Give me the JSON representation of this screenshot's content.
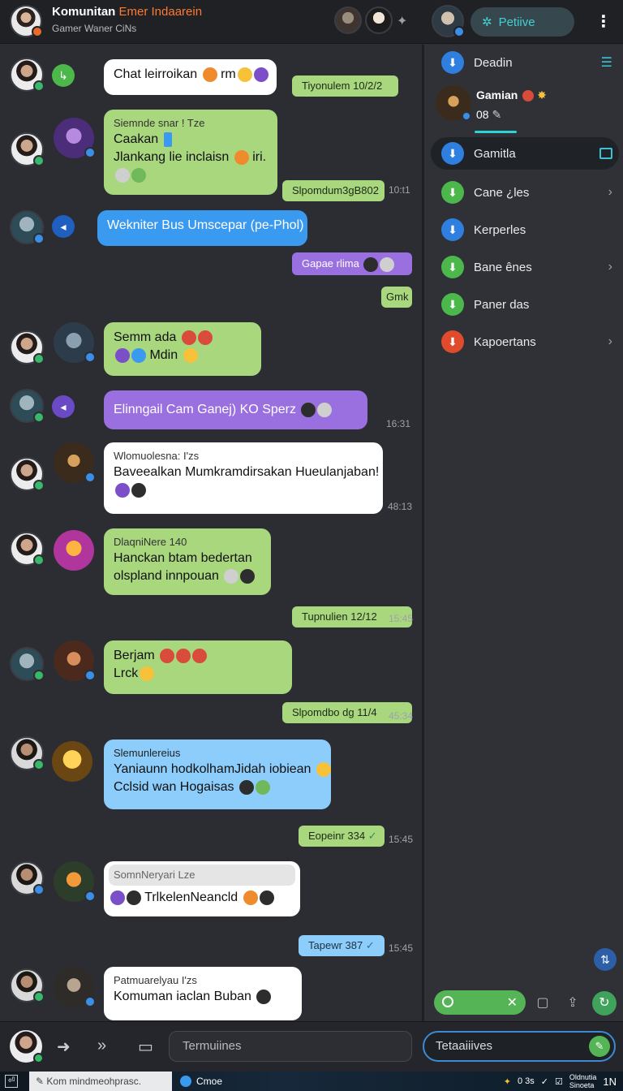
{
  "header": {
    "title_main": "Komunitan ",
    "title_accent": "Emer Indaarein",
    "subtitle": "Gamer Waner CiNs",
    "positive_label": "Petiive",
    "positive_icon": "sparkle-icon",
    "menu_icon": "kebab-icon"
  },
  "messages": [
    {
      "text": "Chat leirroikan",
      "tail": "rm"
    },
    {
      "sender": "Siemnde snar ! Tze",
      "line1": "Caakan",
      "line2": "Jlankang lie inclaisn",
      "line2_tail": "iri."
    },
    {
      "text": "Wekniter Bus Umscepar (pe-Phol)"
    },
    {
      "line1": "Semm ada",
      "line2": "Mdin"
    },
    {
      "text": "Elinngail Cam Ganej) KO Sperz"
    },
    {
      "sender": "Wlomuolesna: I'zs",
      "line1": "Baveealkan Mumkramdirsakan Hueulanjaban!"
    },
    {
      "sender": "DlaqniNere 140",
      "line1": "Hanckan btam bedertan",
      "line2": "olspland innpouan"
    },
    {
      "line1": "Berjam",
      "line2": "Lrck"
    },
    {
      "sender": "Slemunlereius",
      "line1": "Yaniaunn hodkolhamJidah iobiean",
      "line2": "Cclsid wan Hogaisas"
    },
    {
      "sender": "SomnNeryari Lze",
      "line1": "TrlkelenNeancld"
    },
    {
      "sender": "Patmuarelyau I'zs",
      "line1": "Komuman iaclan Buban"
    }
  ],
  "outgoing": [
    {
      "text": "Tiyonulem 10/2/2"
    },
    {
      "text": "Slpomdum3gB802"
    },
    {
      "text": "Gapae rlima"
    },
    {
      "text": "Gmk"
    },
    {
      "text": "Tupnulien 12/12"
    },
    {
      "text": "Slpomdbo dg 11/4"
    },
    {
      "text": "Eopeinr 334"
    },
    {
      "text": "Tapewr 387"
    }
  ],
  "timestamps": [
    "10:t1",
    "16:31",
    "48:13",
    "15:45",
    "45:34",
    "15:45",
    "15:45"
  ],
  "sidebar": {
    "items": [
      {
        "label": "Deadin",
        "icon": "download-icon",
        "color": "#2f7fe0"
      },
      {
        "label": "Gamitla",
        "icon": "download-icon",
        "color": "#2f7fe0"
      },
      {
        "label": "Cane ¿les",
        "icon": "download-icon",
        "color": "#4cb84c"
      },
      {
        "label": "Kerperles",
        "icon": "download-icon",
        "color": "#2f7fe0"
      },
      {
        "label": "Bane ênes",
        "icon": "download-icon",
        "color": "#4cb84c"
      },
      {
        "label": "Paner das",
        "icon": "download-icon",
        "color": "#4cb84c"
      },
      {
        "label": "Kapoertans",
        "icon": "download-icon",
        "color": "#e04b2c"
      }
    ],
    "game": {
      "name": "Gamian",
      "number": "08"
    }
  },
  "composer": {
    "placeholder": "Termuiines",
    "second_placeholder": "Tetaaiiives"
  },
  "taskbar": {
    "tab": "Kom mindmeohprasc.",
    "app": "Cmoe",
    "tray_text": "0 3s",
    "clock_line1": "Oldnutia",
    "clock_line2": "Sinoeta",
    "corner": "1N"
  },
  "colors": {
    "accent": "#ff7a2f",
    "positive": "#42d0d4",
    "green_bubble": "#a8d77e",
    "blue_bubble": "#3a9af0",
    "purple_bubble": "#9a6fe0"
  }
}
